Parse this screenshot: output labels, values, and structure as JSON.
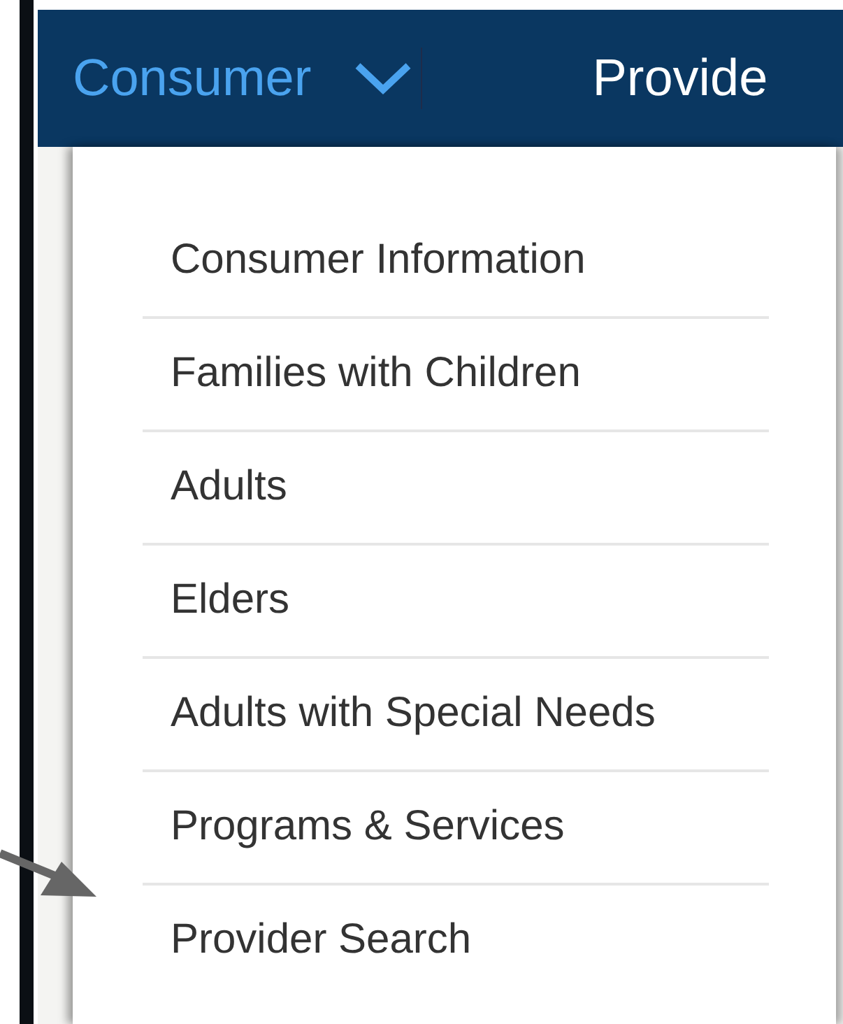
{
  "nav": {
    "items": [
      {
        "label": "Consumer",
        "selected": true,
        "kind": "dropdown"
      },
      {
        "label": "Provide",
        "selected": false,
        "kind": "link"
      }
    ]
  },
  "dropdown": {
    "items": [
      "Consumer Information",
      "Families with Children",
      "Adults",
      "Elders",
      "Adults with Special Needs",
      "Programs & Services",
      "Provider Search"
    ]
  }
}
